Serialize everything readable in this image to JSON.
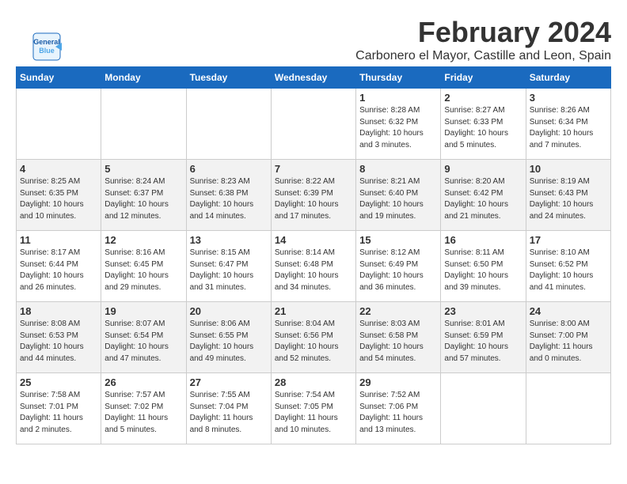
{
  "logo": {
    "line1": "General",
    "line2": "Blue"
  },
  "header": {
    "month_year": "February 2024",
    "location": "Carbonero el Mayor, Castille and Leon, Spain"
  },
  "weekdays": [
    "Sunday",
    "Monday",
    "Tuesday",
    "Wednesday",
    "Thursday",
    "Friday",
    "Saturday"
  ],
  "weeks": [
    [
      {
        "day": "",
        "info": ""
      },
      {
        "day": "",
        "info": ""
      },
      {
        "day": "",
        "info": ""
      },
      {
        "day": "",
        "info": ""
      },
      {
        "day": "1",
        "info": "Sunrise: 8:28 AM\nSunset: 6:32 PM\nDaylight: 10 hours\nand 3 minutes."
      },
      {
        "day": "2",
        "info": "Sunrise: 8:27 AM\nSunset: 6:33 PM\nDaylight: 10 hours\nand 5 minutes."
      },
      {
        "day": "3",
        "info": "Sunrise: 8:26 AM\nSunset: 6:34 PM\nDaylight: 10 hours\nand 7 minutes."
      }
    ],
    [
      {
        "day": "4",
        "info": "Sunrise: 8:25 AM\nSunset: 6:35 PM\nDaylight: 10 hours\nand 10 minutes."
      },
      {
        "day": "5",
        "info": "Sunrise: 8:24 AM\nSunset: 6:37 PM\nDaylight: 10 hours\nand 12 minutes."
      },
      {
        "day": "6",
        "info": "Sunrise: 8:23 AM\nSunset: 6:38 PM\nDaylight: 10 hours\nand 14 minutes."
      },
      {
        "day": "7",
        "info": "Sunrise: 8:22 AM\nSunset: 6:39 PM\nDaylight: 10 hours\nand 17 minutes."
      },
      {
        "day": "8",
        "info": "Sunrise: 8:21 AM\nSunset: 6:40 PM\nDaylight: 10 hours\nand 19 minutes."
      },
      {
        "day": "9",
        "info": "Sunrise: 8:20 AM\nSunset: 6:42 PM\nDaylight: 10 hours\nand 21 minutes."
      },
      {
        "day": "10",
        "info": "Sunrise: 8:19 AM\nSunset: 6:43 PM\nDaylight: 10 hours\nand 24 minutes."
      }
    ],
    [
      {
        "day": "11",
        "info": "Sunrise: 8:17 AM\nSunset: 6:44 PM\nDaylight: 10 hours\nand 26 minutes."
      },
      {
        "day": "12",
        "info": "Sunrise: 8:16 AM\nSunset: 6:45 PM\nDaylight: 10 hours\nand 29 minutes."
      },
      {
        "day": "13",
        "info": "Sunrise: 8:15 AM\nSunset: 6:47 PM\nDaylight: 10 hours\nand 31 minutes."
      },
      {
        "day": "14",
        "info": "Sunrise: 8:14 AM\nSunset: 6:48 PM\nDaylight: 10 hours\nand 34 minutes."
      },
      {
        "day": "15",
        "info": "Sunrise: 8:12 AM\nSunset: 6:49 PM\nDaylight: 10 hours\nand 36 minutes."
      },
      {
        "day": "16",
        "info": "Sunrise: 8:11 AM\nSunset: 6:50 PM\nDaylight: 10 hours\nand 39 minutes."
      },
      {
        "day": "17",
        "info": "Sunrise: 8:10 AM\nSunset: 6:52 PM\nDaylight: 10 hours\nand 41 minutes."
      }
    ],
    [
      {
        "day": "18",
        "info": "Sunrise: 8:08 AM\nSunset: 6:53 PM\nDaylight: 10 hours\nand 44 minutes."
      },
      {
        "day": "19",
        "info": "Sunrise: 8:07 AM\nSunset: 6:54 PM\nDaylight: 10 hours\nand 47 minutes."
      },
      {
        "day": "20",
        "info": "Sunrise: 8:06 AM\nSunset: 6:55 PM\nDaylight: 10 hours\nand 49 minutes."
      },
      {
        "day": "21",
        "info": "Sunrise: 8:04 AM\nSunset: 6:56 PM\nDaylight: 10 hours\nand 52 minutes."
      },
      {
        "day": "22",
        "info": "Sunrise: 8:03 AM\nSunset: 6:58 PM\nDaylight: 10 hours\nand 54 minutes."
      },
      {
        "day": "23",
        "info": "Sunrise: 8:01 AM\nSunset: 6:59 PM\nDaylight: 10 hours\nand 57 minutes."
      },
      {
        "day": "24",
        "info": "Sunrise: 8:00 AM\nSunset: 7:00 PM\nDaylight: 11 hours\nand 0 minutes."
      }
    ],
    [
      {
        "day": "25",
        "info": "Sunrise: 7:58 AM\nSunset: 7:01 PM\nDaylight: 11 hours\nand 2 minutes."
      },
      {
        "day": "26",
        "info": "Sunrise: 7:57 AM\nSunset: 7:02 PM\nDaylight: 11 hours\nand 5 minutes."
      },
      {
        "day": "27",
        "info": "Sunrise: 7:55 AM\nSunset: 7:04 PM\nDaylight: 11 hours\nand 8 minutes."
      },
      {
        "day": "28",
        "info": "Sunrise: 7:54 AM\nSunset: 7:05 PM\nDaylight: 11 hours\nand 10 minutes."
      },
      {
        "day": "29",
        "info": "Sunrise: 7:52 AM\nSunset: 7:06 PM\nDaylight: 11 hours\nand 13 minutes."
      },
      {
        "day": "",
        "info": ""
      },
      {
        "day": "",
        "info": ""
      }
    ]
  ]
}
